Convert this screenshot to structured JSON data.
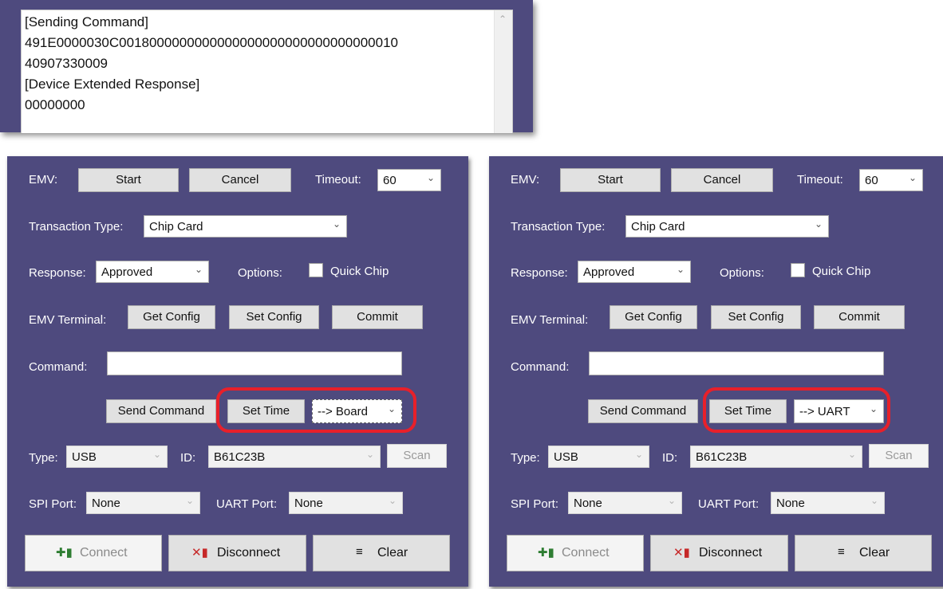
{
  "log": {
    "lines": [
      "[Sending Command]",
      "491E0000030C0018000000000000000000000000000000010",
      "40907330009",
      "[Device Extended Response]",
      "00000000"
    ]
  },
  "panels": [
    {
      "emv_label": "EMV:",
      "start_label": "Start",
      "cancel_label": "Cancel",
      "timeout_label": "Timeout:",
      "timeout_value": "60",
      "transaction_type_label": "Transaction Type:",
      "transaction_type_value": "Chip Card",
      "response_label": "Response:",
      "response_value": "Approved",
      "options_label": "Options:",
      "quick_chip_label": "Quick Chip",
      "emv_terminal_label": "EMV Terminal:",
      "get_config_label": "Get Config",
      "set_config_label": "Set Config",
      "commit_label": "Commit",
      "command_label": "Command:",
      "command_value": "",
      "send_command_label": "Send Command",
      "set_time_label": "Set Time",
      "target_value": "--> Board",
      "type_label": "Type:",
      "type_value": "USB",
      "id_label": "ID:",
      "id_value": "B61C23B",
      "scan_label": "Scan",
      "spi_port_label": "SPI Port:",
      "spi_port_value": "None",
      "uart_port_label": "UART Port:",
      "uart_port_value": "None",
      "connect_label": "Connect",
      "disconnect_label": "Disconnect",
      "clear_label": "Clear"
    },
    {
      "emv_label": "EMV:",
      "start_label": "Start",
      "cancel_label": "Cancel",
      "timeout_label": "Timeout:",
      "timeout_value": "60",
      "transaction_type_label": "Transaction Type:",
      "transaction_type_value": "Chip Card",
      "response_label": "Response:",
      "response_value": "Approved",
      "options_label": "Options:",
      "quick_chip_label": "Quick Chip",
      "emv_terminal_label": "EMV Terminal:",
      "get_config_label": "Get Config",
      "set_config_label": "Set Config",
      "commit_label": "Commit",
      "command_label": "Command:",
      "command_value": "",
      "send_command_label": "Send Command",
      "set_time_label": "Set Time",
      "target_value": "--> UART",
      "type_label": "Type:",
      "type_value": "USB",
      "id_label": "ID:",
      "id_value": "B61C23B",
      "scan_label": "Scan",
      "spi_port_label": "SPI Port:",
      "spi_port_value": "None",
      "uart_port_label": "UART Port:",
      "uart_port_value": "None",
      "connect_label": "Connect",
      "disconnect_label": "Disconnect",
      "clear_label": "Clear"
    }
  ],
  "icons": {
    "dropdown": "chevron-down-icon",
    "scroll_up": "chevron-up-icon",
    "connect": "plug-plus-icon",
    "disconnect": "plug-x-icon",
    "clear": "clear-list-icon"
  },
  "colors": {
    "panel_bg": "#4e4a7e",
    "highlight": "#e8202a",
    "button_bg": "#e1e1e1"
  }
}
